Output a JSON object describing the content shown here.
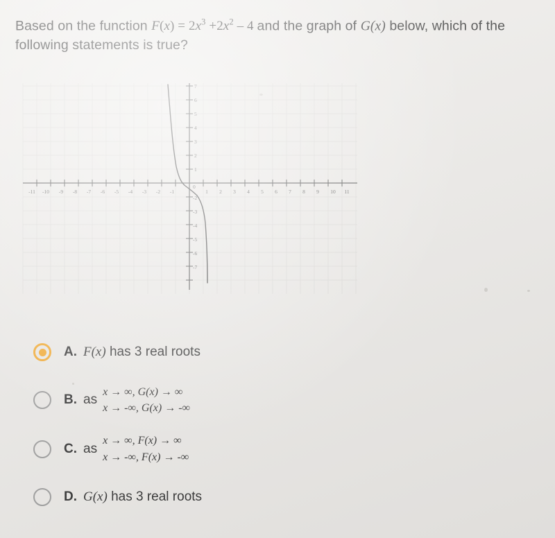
{
  "question": {
    "prefix": "Based on the function",
    "function_expr": "F(x) = 2x³ + 2x² – 4",
    "function_parts": {
      "name": "F",
      "var": "x",
      "equals": "=",
      "term1_coef": "2",
      "term1_base": "x",
      "term1_exp": "3",
      "plus": "+",
      "term2_coef": "2",
      "term2_base": "x",
      "term2_exp": "2",
      "minus": "–",
      "constant": "4"
    },
    "middle": "and the graph of",
    "graph_name": "G(x)",
    "suffix": "below, which of the following statements is true?"
  },
  "graph": {
    "x_axis_labels": [
      "-11",
      "-10",
      "-9",
      "-8",
      "-7",
      "-6",
      "-5",
      "-4",
      "-3",
      "-2",
      "-1",
      "1",
      "2",
      "3",
      "4",
      "5",
      "6",
      "7",
      "8",
      "9",
      "10",
      "11"
    ],
    "y_axis_labels": [
      "7",
      "6",
      "5",
      "4",
      "3",
      "2",
      "1",
      "0",
      "-2",
      "-3",
      "-4",
      "-5",
      "-6",
      "-7"
    ],
    "origin_label": "0",
    "curve_description": "steeply decreasing cubic-like curve crossing x-axis near x = -1",
    "grid_color": "#d5d3d0",
    "axis_color": "#4a4a4a",
    "curve_color": "#3a3a3a"
  },
  "choices": [
    {
      "letter": "A.",
      "selected": true,
      "layout": "simple",
      "text_before_ital": "",
      "ital": "F(x)",
      "text_after_ital": " has 3 real roots"
    },
    {
      "letter": "B.",
      "selected": false,
      "layout": "limit",
      "as_word": "as",
      "line1": "x → ∞,  G(x) → ∞",
      "line2": "x → -∞,  G(x) → -∞"
    },
    {
      "letter": "C.",
      "selected": false,
      "layout": "limit",
      "as_word": "as",
      "line1": "x → ∞,  F(x) → ∞",
      "line2": "x → -∞,  F(x) → -∞"
    },
    {
      "letter": "D.",
      "selected": false,
      "layout": "simple",
      "text_before_ital": "",
      "ital": "G(x)",
      "text_after_ital": " has 3 real roots"
    }
  ],
  "colors": {
    "page_background": "#eceae7",
    "text": "#2b2b2b",
    "selected_radio": "#f5a623",
    "unselected_radio": "#9a9a9a"
  }
}
